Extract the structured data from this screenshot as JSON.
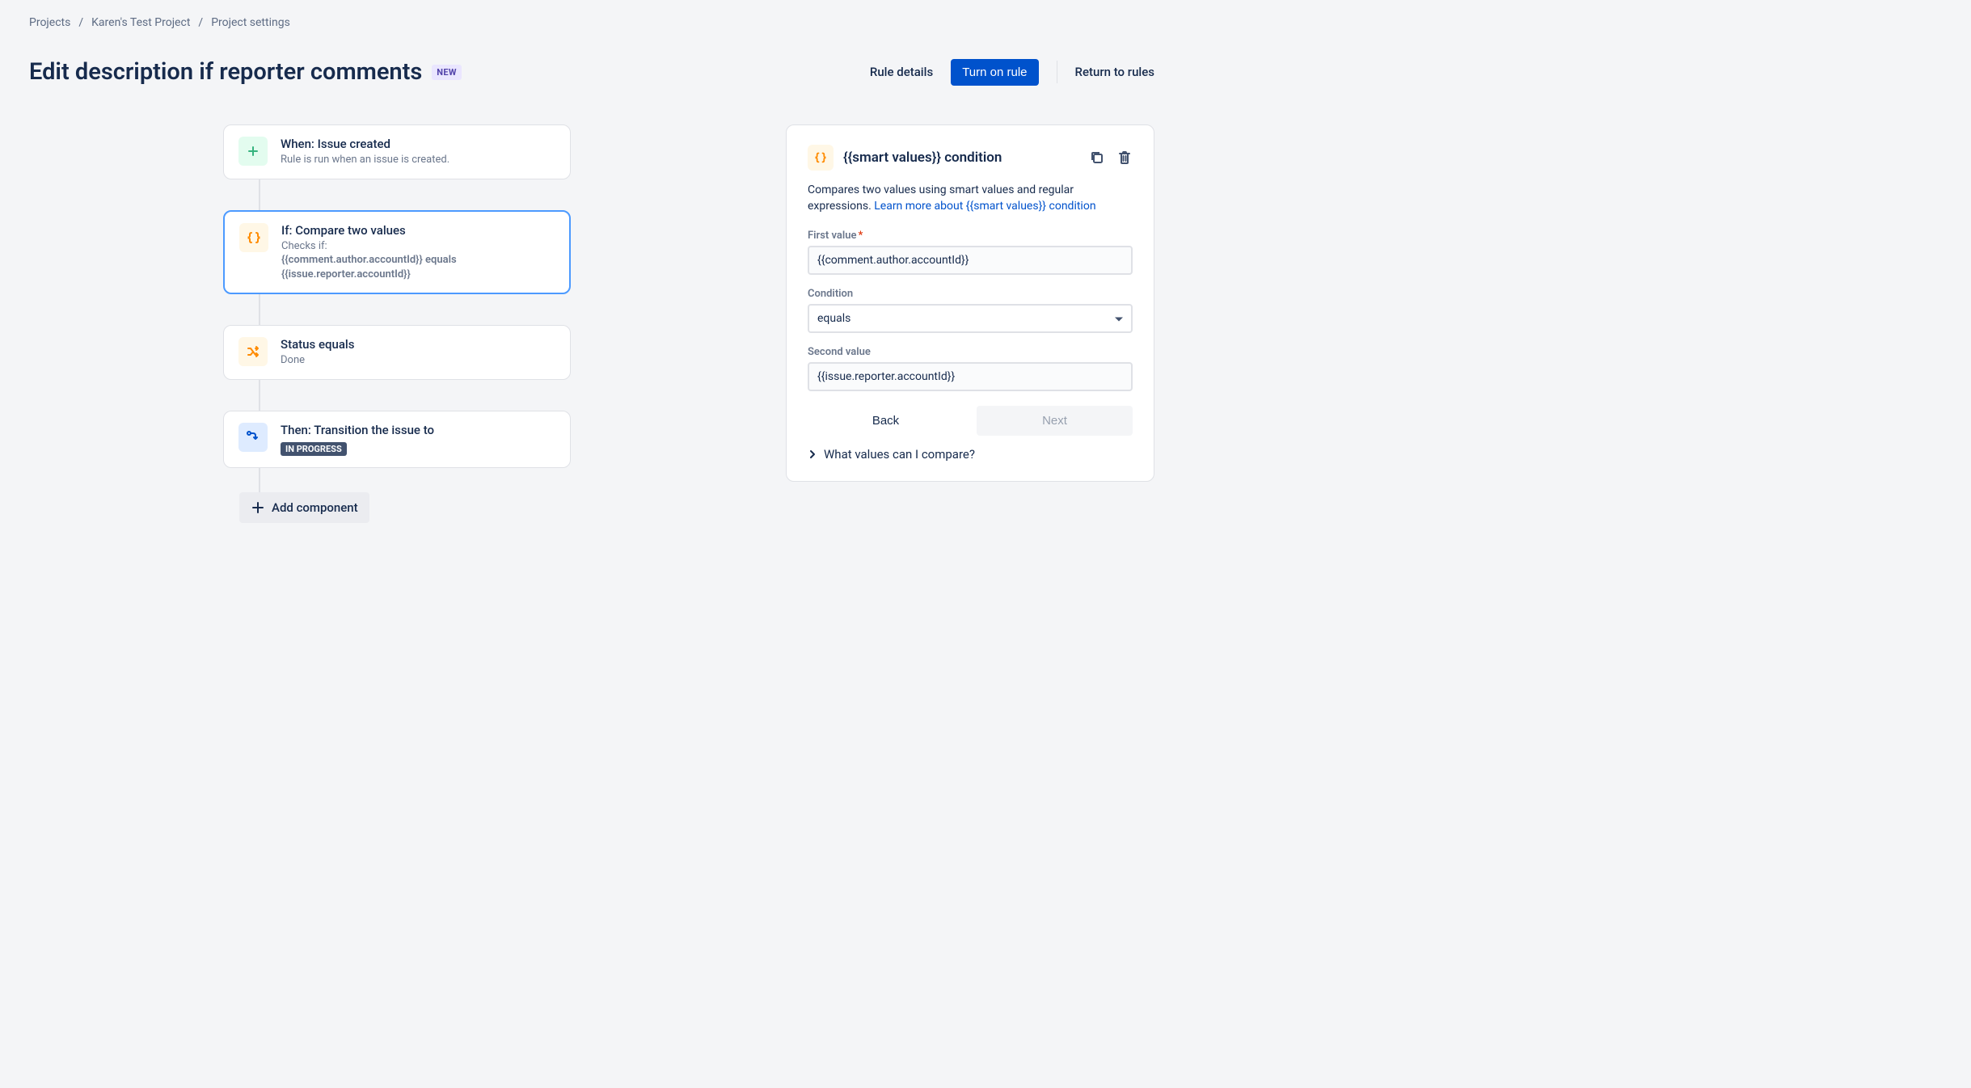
{
  "breadcrumb": {
    "items": [
      "Projects",
      "Karen's Test Project",
      "Project settings"
    ]
  },
  "header": {
    "title": "Edit description if reporter comments",
    "badge": "NEW",
    "rule_details": "Rule details",
    "turn_on": "Turn on rule",
    "return": "Return to rules"
  },
  "nodes": {
    "trigger": {
      "title": "When: Issue created",
      "sub": "Rule is run when an issue is created."
    },
    "condition1": {
      "title": "If: Compare two values",
      "sub_prefix": "Checks if:",
      "sub_detail": "{{comment.author.accountId}} equals {{issue.reporter.accountId}}"
    },
    "condition2": {
      "title": "Status equals",
      "sub": "Done"
    },
    "action": {
      "title": "Then: Transition the issue to",
      "lozenge": "IN PROGRESS"
    },
    "add": "Add component"
  },
  "panel": {
    "title": "{{smart values}} condition",
    "desc_text": "Compares two values using smart values and regular expressions. ",
    "link_text": "Learn more about {{smart values}} condition",
    "first_value_label": "First value",
    "first_value": "{{comment.author.accountId}}",
    "condition_label": "Condition",
    "condition_value": "equals",
    "second_value_label": "Second value",
    "second_value": "{{issue.reporter.accountId}}",
    "back": "Back",
    "next": "Next",
    "expand": "What values can I compare?"
  }
}
